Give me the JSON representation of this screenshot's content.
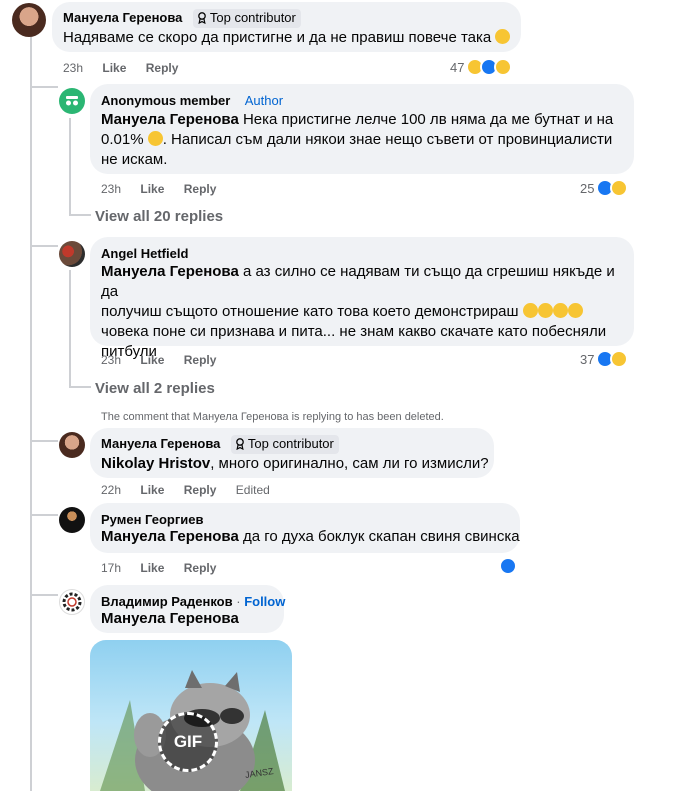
{
  "comments": [
    {
      "author": "Мануела Геренова",
      "badge": "Top contributor",
      "text": "Надяваме се скоро да пристигне и да не правиш повече така",
      "time": "23h",
      "like": "Like",
      "reply": "Reply",
      "reactions": "47"
    },
    {
      "author": "Anonymous member",
      "author_tag": "Author",
      "mention": "Мануела Геренова",
      "text_line1": " Нека пристигне лелче 100 лв няма да ме бутнат и на",
      "text_line2": "0.01%",
      "text_line2b": ". Написал съм дали някои знае нещо съвети от провинциалисти",
      "text_line3": "не искам.",
      "time": "23h",
      "like": "Like",
      "reply": "Reply",
      "reactions": "25",
      "view_replies": "View all 20 replies"
    },
    {
      "author": "Angel Hetfield",
      "mention": "Мануела Геренова",
      "text_line1": " а аз силно се надявам ти също да сгрешиш някъде и да",
      "text_line2": "получиш същото отношение като това което демонстрираш",
      "text_line3": "човека поне си признава и пита... не знам какво скачате като побесняли",
      "text_line4": "питбули",
      "time": "23h",
      "like": "Like",
      "reply": "Reply",
      "reactions": "37",
      "view_replies": "View all 2 replies"
    },
    {
      "deleted_notice": "The comment that Мануела Геренова is replying to has been deleted.",
      "author": "Мануела Геренова",
      "badge": "Top contributor",
      "mention": "Nikolay Hristov",
      "text": ", много оригинално, сам ли го измисли?",
      "time": "22h",
      "like": "Like",
      "reply": "Reply",
      "edited": "Edited"
    },
    {
      "author": "Румен Георгиев",
      "mention": "Мануела Геренова",
      "text": " да го духа боклук скапан свиня свинска",
      "time": "17h",
      "like": "Like",
      "reply": "Reply"
    },
    {
      "author": "Владимир Раденков",
      "follow": "Follow",
      "follow_sep": " · ",
      "mention": "Мануела Геренова",
      "gif_label": "GIF",
      "gif_watermark": "JANSZ"
    }
  ],
  "colors": {
    "bubble": "#f0f2f5",
    "link": "#0064d1",
    "muted": "#65676b",
    "like_blue": "#1877f2",
    "emoji_yellow": "#f7c533"
  }
}
